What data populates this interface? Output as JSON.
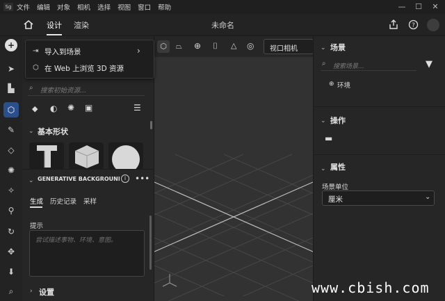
{
  "app": {
    "logo": "Sg"
  },
  "menu": [
    "文件",
    "编辑",
    "对象",
    "相机",
    "选择",
    "视图",
    "窗口",
    "帮助"
  ],
  "window_controls": {
    "minimize": "—",
    "maximize": "☐",
    "close": "✕"
  },
  "top": {
    "home_icon": "home-icon",
    "tab_design": "设计",
    "tab_render": "渲染",
    "title": "未命名"
  },
  "popup": {
    "import": "导入到场景",
    "browse": "在 Web 上浏览 3D 资源",
    "arrow": "›"
  },
  "left": {
    "search_placeholder": "搜索初始资源...",
    "basic_shapes": "基本形状",
    "generative": "GENERATIVE BACKGROUND",
    "subtabs": [
      "生成",
      "历史记录",
      "采样"
    ],
    "prompt_label": "提示",
    "prompt_placeholder": "尝试描述事物、环境、意图。",
    "settings": "设置"
  },
  "viewport": {
    "camera_select": "视口相机"
  },
  "right": {
    "scene": "场景",
    "scene_search_placeholder": "搜索场景...",
    "env": "环境",
    "actions": "操作",
    "properties": "属性",
    "scene_unit_label": "场景单位",
    "scene_unit_value": "厘米"
  },
  "watermark": "www.cbish.com",
  "colors": {
    "accent": "#2b4f8a",
    "panel": "#262626",
    "viewport": "#323232"
  }
}
